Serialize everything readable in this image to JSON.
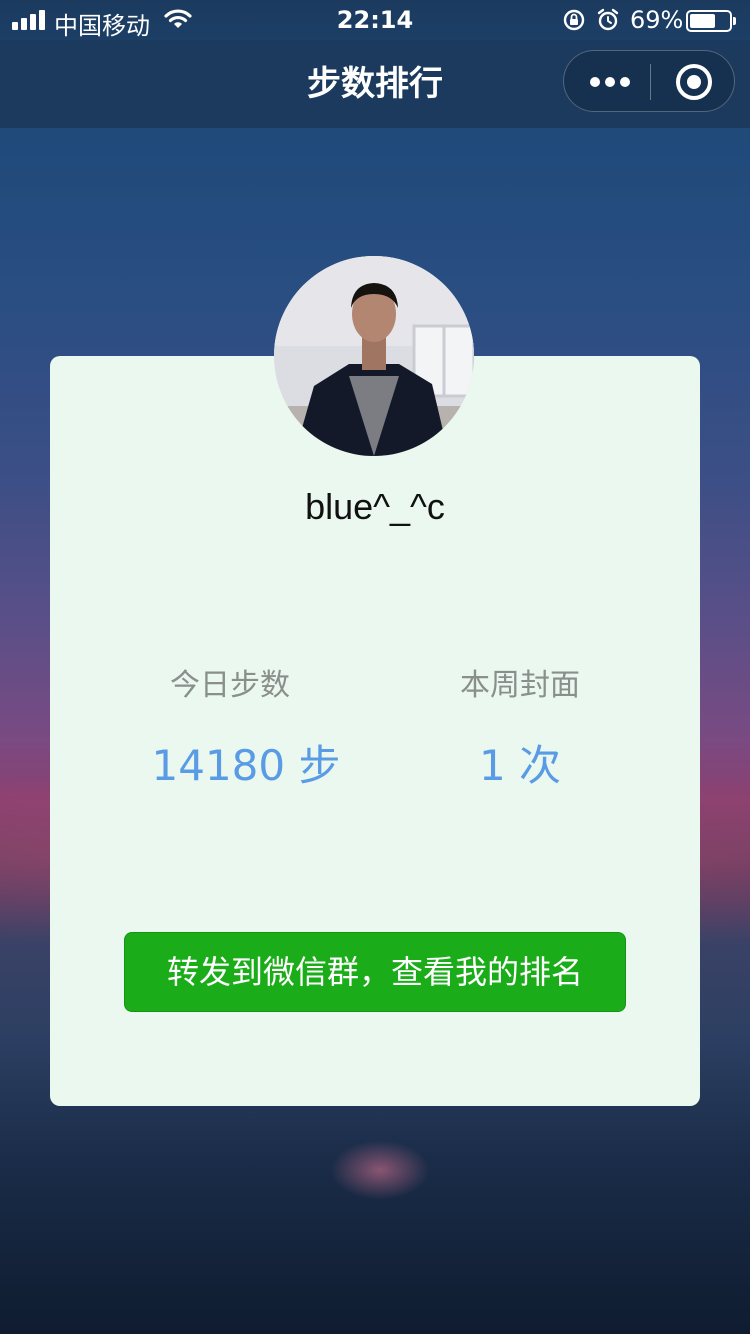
{
  "status_bar": {
    "carrier": "中国移动",
    "time": "22:14",
    "battery_percent": "69%",
    "battery_level": 0.69
  },
  "nav": {
    "title": "步数排行"
  },
  "profile": {
    "username": "blue^_^c"
  },
  "stats": {
    "today_steps_label": "今日步数",
    "today_steps_value": "14180 步",
    "weekly_cover_label": "本周封面",
    "weekly_cover_value": "1 次"
  },
  "share_button_label": "转发到微信群，查看我的排名",
  "colors": {
    "accent_blue": "#5a9be6",
    "button_green": "#1aad19",
    "card_bg": "#eaf8ef"
  }
}
